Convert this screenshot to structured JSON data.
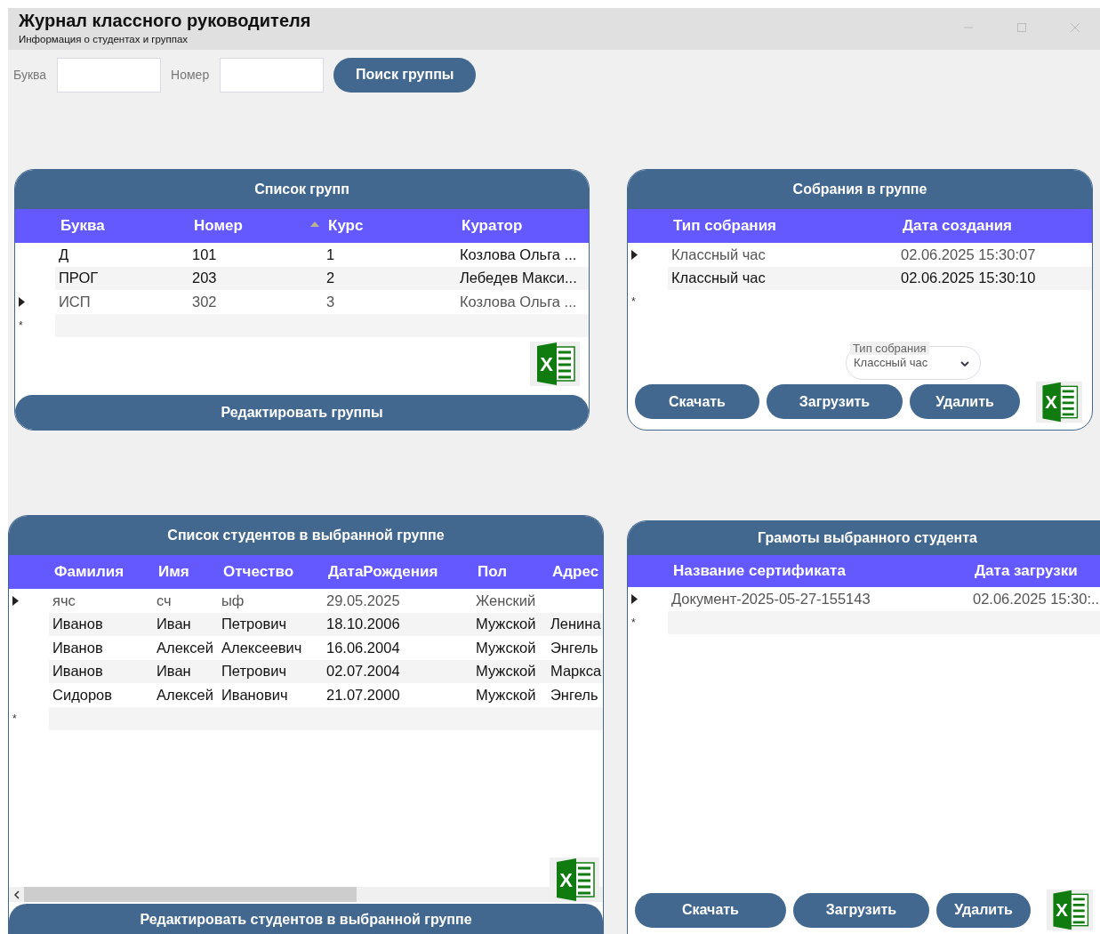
{
  "window": {
    "title": "Журнал классного руководителя",
    "subtitle": "Информация о студентах и группах"
  },
  "search": {
    "fields": [
      {
        "label": "Буква"
      },
      {
        "label": "Номер"
      }
    ],
    "button": "Поиск группы"
  },
  "panels": [
    {
      "title": "Список групп",
      "columns": [
        {
          "label": "Буква",
          "sorted": false
        },
        {
          "label": "Номер",
          "sorted": false
        },
        {
          "label": "Курс",
          "sorted": true
        },
        {
          "label": "Куратор",
          "sorted": false
        }
      ],
      "rows": [
        {
          "cells": [
            "Д",
            "101",
            "1",
            "Козлова Ольга ..."
          ],
          "current": false
        },
        {
          "cells": [
            "ПРОГ",
            "203",
            "2",
            "Лебедев Макси..."
          ],
          "current": false
        },
        {
          "cells": [
            "ИСП",
            "302",
            "3",
            "Козлова Ольга ..."
          ],
          "current": true
        }
      ],
      "new_row_marker": "*",
      "excel_label": "X",
      "edit_button": "Редактировать группы"
    },
    {
      "title": "Собрания в группе",
      "columns": [
        {
          "label": "Тип собрания",
          "sorted": false
        },
        {
          "label": "Дата создания",
          "sorted": false
        }
      ],
      "rows": [
        {
          "cells": [
            "Классный час",
            "02.06.2025 15:30:07"
          ],
          "current": true
        },
        {
          "cells": [
            "Классный час",
            "02.06.2025 15:30:10"
          ],
          "current": false
        }
      ],
      "new_row_marker": "*",
      "type_select": {
        "label": "Тип собрания",
        "value": "Классный час"
      },
      "buttons": [
        "Скачать",
        "Загрузить",
        "Удалить"
      ],
      "excel_label": "X"
    },
    {
      "title": "Список студентов в выбранной группе",
      "columns": [
        {
          "label": "Фамилия",
          "sorted": false
        },
        {
          "label": "Имя",
          "sorted": false
        },
        {
          "label": "Отчество",
          "sorted": false
        },
        {
          "label": "ДатаРождения",
          "sorted": false
        },
        {
          "label": "Пол",
          "sorted": false
        },
        {
          "label": "Адрес",
          "sorted": false
        }
      ],
      "rows": [
        {
          "cells": [
            "ячс",
            "сч",
            "ыф",
            "29.05.2025",
            "Женский"
          ],
          "current": true
        },
        {
          "cells": [
            "Иванов",
            "Иван",
            "Петрович",
            "18.10.2006",
            "Мужской",
            "Ленина"
          ],
          "current": false
        },
        {
          "cells": [
            "Иванов",
            "Алексей",
            "Алексеевич",
            "16.06.2004",
            "Мужской",
            "Энгель"
          ],
          "current": false
        },
        {
          "cells": [
            "Иванов",
            "Иван",
            "Петрович",
            "02.07.2004",
            "Мужской",
            "Маркса"
          ],
          "current": false
        },
        {
          "cells": [
            "Сидоров",
            "Алексей",
            "Иванович",
            "21.07.2000",
            "Мужской",
            "Энгель"
          ],
          "current": false
        }
      ],
      "new_row_marker": "*",
      "excel_label": "X",
      "edit_button": "Редактировать студентов в выбранной группе"
    },
    {
      "title": "Грамоты выбранного студента",
      "columns": [
        {
          "label": "Название сертификата",
          "sorted": false
        },
        {
          "label": "Дата загрузки",
          "sorted": false
        }
      ],
      "rows": [
        {
          "cells": [
            "Документ-2025-05-27-155143",
            "02.06.2025 15:30:.."
          ],
          "current": true
        }
      ],
      "new_row_marker": "*",
      "buttons": [
        "Скачать",
        "Загрузить",
        "Удалить"
      ],
      "excel_label": "X"
    }
  ]
}
